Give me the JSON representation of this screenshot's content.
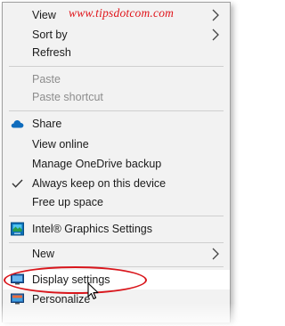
{
  "watermark": "www.tipsdotcom.com",
  "menu": {
    "view": "View",
    "sort_by": "Sort by",
    "refresh": "Refresh",
    "paste": "Paste",
    "paste_shortcut": "Paste shortcut",
    "share": "Share",
    "view_online": "View online",
    "manage_onedrive": "Manage OneDrive backup",
    "always_keep": "Always keep on this device",
    "free_up": "Free up space",
    "intel_graphics": "Intel® Graphics Settings",
    "new": "New",
    "display_settings": "Display settings",
    "personalize": "Personalize"
  },
  "colors": {
    "menu_background": "#f2f2f2",
    "disabled_text": "#8d8d8d",
    "highlight_red": "#d9161c",
    "onedrive_blue": "#0f6cbd"
  },
  "icons": {
    "share": "onedrive-cloud-icon",
    "always_keep": "checkmark-icon",
    "intel_graphics": "intel-graphics-icon",
    "display_settings": "display-monitor-icon",
    "personalize": "personalize-monitor-icon",
    "submenu": "chevron-right-icon",
    "cursor": "mouse-pointer-icon"
  }
}
